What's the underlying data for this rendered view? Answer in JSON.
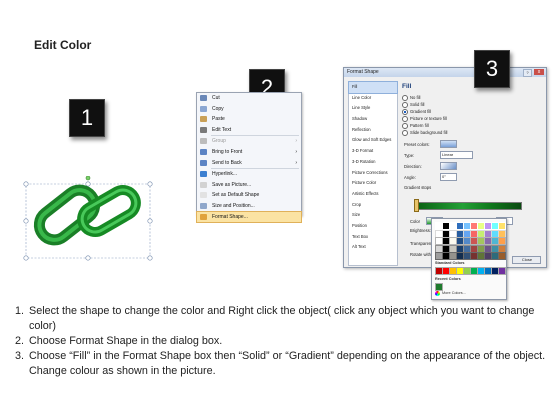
{
  "page": {
    "title": "Edit Color"
  },
  "badges": {
    "step1": "1",
    "step2": "2",
    "step3": "3"
  },
  "context_menu": {
    "items": [
      {
        "label": "Cut"
      },
      {
        "label": "Copy"
      },
      {
        "label": "Paste"
      },
      {
        "label": "Edit Text"
      },
      {
        "label": "Group"
      },
      {
        "label": "Bring to Front"
      },
      {
        "label": "Send to Back"
      },
      {
        "label": "Hyperlink..."
      },
      {
        "label": "Save as Picture..."
      },
      {
        "label": "Set as Default Shape"
      },
      {
        "label": "Size and Position..."
      },
      {
        "label": "Format Shape..."
      }
    ]
  },
  "dialog": {
    "title": "Format Shape",
    "close_label": "x",
    "help_label": "?",
    "sidebar": [
      "Fill",
      "Line Color",
      "Line Style",
      "Shadow",
      "Reflection",
      "Glow and Soft Edges",
      "3-D Format",
      "3-D Rotation",
      "Picture Corrections",
      "Picture Color",
      "Artistic Effects",
      "Crop",
      "Size",
      "Position",
      "Text Box",
      "Alt Text"
    ],
    "fill_heading": "Fill",
    "fill_options": [
      "No fill",
      "Solid fill",
      "Gradient fill",
      "Picture or texture fill",
      "Pattern fill",
      "Slide background fill"
    ],
    "preset_label": "Preset colors:",
    "type_label": "Type:",
    "type_value": "Linear",
    "direction_label": "Direction:",
    "angle_label": "Angle:",
    "angle_value": "0°",
    "gradient_stops_label": "Gradient stops",
    "color_label": "Color",
    "position_label": "Position:",
    "position_value": "0%",
    "brightness_label": "Brightness:",
    "transparency_label": "Transparency:",
    "rotate_label": "Rotate with shape",
    "ok_label": "Close"
  },
  "color_picker": {
    "standard_label": "Standard Colors",
    "recent_label": "Recent Colors",
    "more_label": "More Colors..."
  },
  "instructions": [
    "Select the shape to change the color and Right click the object( click any object which you want to change color)",
    "Choose Format Shape in the dialog box.",
    "Choose “Fill” in the Format Shape box then “Solid” or “Gradient” depending on the appearance of the object. Change colour as shown in the picture."
  ],
  "colors": {
    "link_green": "#1f9a2d",
    "dialog_bg": "#f0f0f0",
    "highlight": "#fbe3a3"
  }
}
